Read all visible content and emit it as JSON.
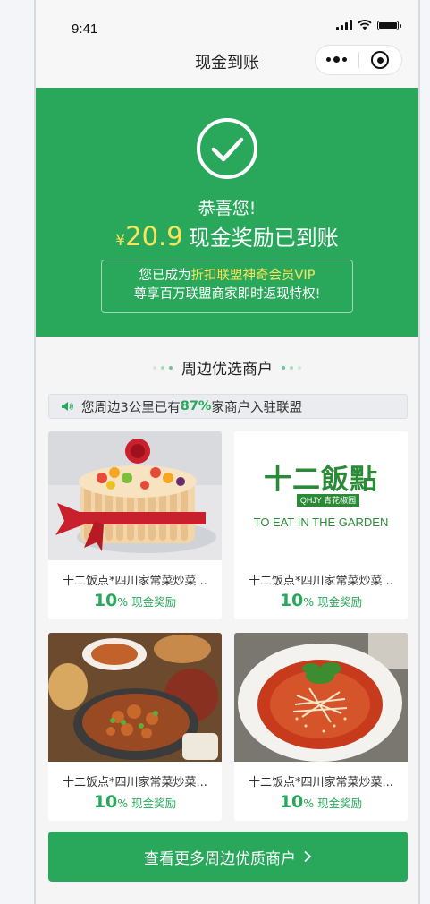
{
  "status": {
    "time": "9:41"
  },
  "nav": {
    "title": "现金到账"
  },
  "hero": {
    "congrats": "恭喜您!",
    "currency": "¥",
    "amount": "20.9",
    "amount_suffix": "现金奖励已到账",
    "vip_line1_prefix": "您已成为",
    "vip_line1_highlight": "折扣联盟神奇会员VIP",
    "vip_line2": "尊享百万联盟商家即时返现特权!"
  },
  "section": {
    "title": "周边优选商户"
  },
  "notice": {
    "prefix": "您周边3公里已有",
    "percent": "87%",
    "suffix": "家商户入驻联盟"
  },
  "merchants": [
    {
      "name": "十二饭点*四川家常菜炒菜...",
      "rate": "10",
      "unit": "%",
      "label": "现金奖励",
      "image": "cake"
    },
    {
      "name": "十二饭点*四川家常菜炒菜...",
      "rate": "10",
      "unit": "%",
      "label": "现金奖励",
      "image": "logo"
    },
    {
      "name": "十二饭点*四川家常菜炒菜...",
      "rate": "10",
      "unit": "%",
      "label": "现金奖励",
      "image": "spread"
    },
    {
      "name": "十二饭点*四川家常菜炒菜...",
      "rate": "10",
      "unit": "%",
      "label": "现金奖励",
      "image": "plate"
    }
  ],
  "logo": {
    "chinese": "十二飯點",
    "badge": "QHJY 青花椒园",
    "english": "TO EAT IN THE GARDEN"
  },
  "cta": {
    "label": "查看更多周边优质商户"
  },
  "colors": {
    "brand_green": "#29a85c",
    "highlight_yellow": "#f9e45a"
  }
}
